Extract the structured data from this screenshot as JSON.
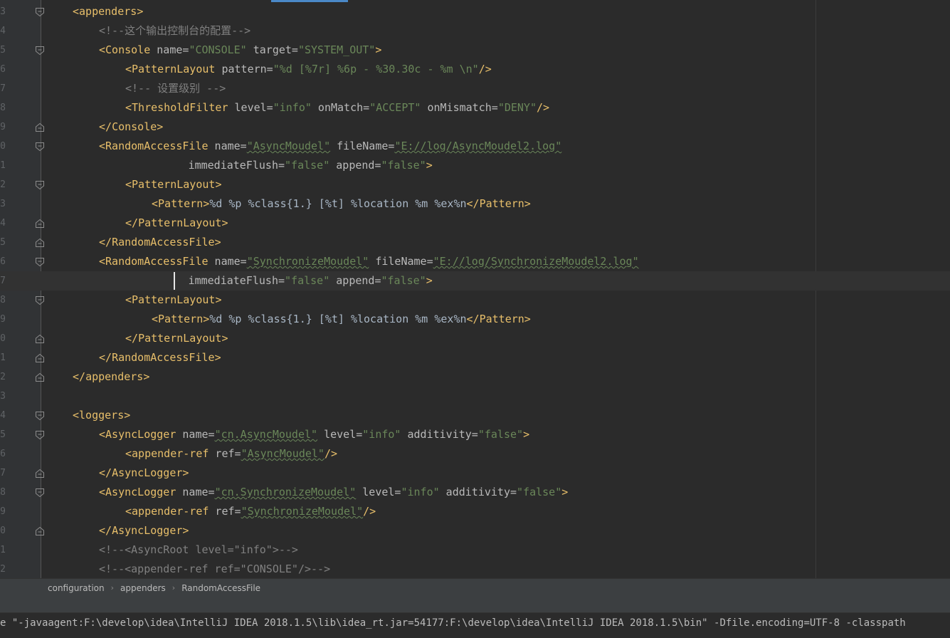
{
  "editor": {
    "lines": [
      {
        "num": "3",
        "indent": 0,
        "fold": "open",
        "tokens": [
          [
            "b",
            "<"
          ],
          [
            "n",
            "appenders"
          ],
          [
            "b",
            ">"
          ]
        ]
      },
      {
        "num": "4",
        "indent": 1,
        "fold": "",
        "tokens": [
          [
            "c",
            "<!--这个输出控制台的配置-->"
          ]
        ]
      },
      {
        "num": "5",
        "indent": 1,
        "fold": "open",
        "tokens": [
          [
            "b",
            "<"
          ],
          [
            "n",
            "Console"
          ],
          [
            "a",
            " name="
          ],
          [
            "v",
            "\"CONSOLE\""
          ],
          [
            "a",
            " target="
          ],
          [
            "v",
            "\"SYSTEM_OUT\""
          ],
          [
            "b",
            ">"
          ]
        ]
      },
      {
        "num": "6",
        "indent": 2,
        "fold": "",
        "tokens": [
          [
            "b",
            "<"
          ],
          [
            "n",
            "PatternLayout"
          ],
          [
            "a",
            " pattern="
          ],
          [
            "v",
            "\"%d [%7r] %6p - %30.30c - %m \\n\""
          ],
          [
            "b",
            "/>"
          ]
        ]
      },
      {
        "num": "7",
        "indent": 2,
        "fold": "",
        "tokens": [
          [
            "c",
            "<!-- 设置级别 -->"
          ]
        ]
      },
      {
        "num": "8",
        "indent": 2,
        "fold": "",
        "tokens": [
          [
            "b",
            "<"
          ],
          [
            "n",
            "ThresholdFilter"
          ],
          [
            "a",
            " level="
          ],
          [
            "v",
            "\"info\""
          ],
          [
            "a",
            " onMatch="
          ],
          [
            "v",
            "\"ACCEPT\""
          ],
          [
            "a",
            " onMismatch="
          ],
          [
            "v",
            "\"DENY\""
          ],
          [
            "b",
            "/>"
          ]
        ]
      },
      {
        "num": "9",
        "indent": 1,
        "fold": "close",
        "tokens": [
          [
            "b",
            "</"
          ],
          [
            "n",
            "Console"
          ],
          [
            "b",
            ">"
          ]
        ]
      },
      {
        "num": "0",
        "indent": 1,
        "fold": "open",
        "tokens": [
          [
            "b",
            "<"
          ],
          [
            "n",
            "RandomAccessFile"
          ],
          [
            "a",
            " name="
          ],
          [
            "vw",
            "\"AsyncMoudel\""
          ],
          [
            "a",
            " fileName="
          ],
          [
            "vw",
            "\"E://log/AsyncMoudel2.log\""
          ]
        ]
      },
      {
        "num": "1",
        "indent": 0,
        "fold": "",
        "tokens": [
          [
            "x",
            "                  "
          ],
          [
            "a",
            "immediateFlush="
          ],
          [
            "v",
            "\"false\""
          ],
          [
            "a",
            " append="
          ],
          [
            "v",
            "\"false\""
          ],
          [
            "b",
            ">"
          ]
        ]
      },
      {
        "num": "2",
        "indent": 2,
        "fold": "open",
        "tokens": [
          [
            "b",
            "<"
          ],
          [
            "n",
            "PatternLayout"
          ],
          [
            "b",
            ">"
          ]
        ]
      },
      {
        "num": "3",
        "indent": 3,
        "fold": "",
        "tokens": [
          [
            "b",
            "<"
          ],
          [
            "n",
            "Pattern"
          ],
          [
            "b",
            ">"
          ],
          [
            "x",
            "%d %p %class{1.} [%t] %location %m %ex%n"
          ],
          [
            "b",
            "</"
          ],
          [
            "n",
            "Pattern"
          ],
          [
            "b",
            ">"
          ]
        ]
      },
      {
        "num": "4",
        "indent": 2,
        "fold": "close",
        "tokens": [
          [
            "b",
            "</"
          ],
          [
            "n",
            "PatternLayout"
          ],
          [
            "b",
            ">"
          ]
        ]
      },
      {
        "num": "5",
        "indent": 1,
        "fold": "close",
        "tokens": [
          [
            "b",
            "</"
          ],
          [
            "n",
            "RandomAccessFile"
          ],
          [
            "b",
            ">"
          ]
        ]
      },
      {
        "num": "6",
        "indent": 1,
        "fold": "open",
        "tokens": [
          [
            "b",
            "<"
          ],
          [
            "n",
            "RandomAccessFile"
          ],
          [
            "a",
            " name="
          ],
          [
            "vw",
            "\"SynchronizeMoudel\""
          ],
          [
            "a",
            " fileName="
          ],
          [
            "vw",
            "\"E://log/SynchronizeMoudel2.log\""
          ]
        ]
      },
      {
        "num": "7",
        "indent": 0,
        "fold": "",
        "current": true,
        "tokens": [
          [
            "x",
            "                  "
          ],
          [
            "a",
            "immediateFlush="
          ],
          [
            "v",
            "\"false\""
          ],
          [
            "a",
            " append="
          ],
          [
            "v",
            "\"false\""
          ],
          [
            "b",
            ">"
          ]
        ]
      },
      {
        "num": "8",
        "indent": 2,
        "fold": "open",
        "tokens": [
          [
            "b",
            "<"
          ],
          [
            "n",
            "PatternLayout"
          ],
          [
            "b",
            ">"
          ]
        ]
      },
      {
        "num": "9",
        "indent": 3,
        "fold": "",
        "tokens": [
          [
            "b",
            "<"
          ],
          [
            "n",
            "Pattern"
          ],
          [
            "b",
            ">"
          ],
          [
            "x",
            "%d %p %class{1.} [%t] %location %m %ex%n"
          ],
          [
            "b",
            "</"
          ],
          [
            "n",
            "Pattern"
          ],
          [
            "b",
            ">"
          ]
        ]
      },
      {
        "num": "0",
        "indent": 2,
        "fold": "close",
        "tokens": [
          [
            "b",
            "</"
          ],
          [
            "n",
            "PatternLayout"
          ],
          [
            "b",
            ">"
          ]
        ]
      },
      {
        "num": "1",
        "indent": 1,
        "fold": "close",
        "tokens": [
          [
            "b",
            "</"
          ],
          [
            "n",
            "RandomAccessFile"
          ],
          [
            "b",
            ">"
          ]
        ]
      },
      {
        "num": "2",
        "indent": 0,
        "fold": "close",
        "tokens": [
          [
            "b",
            "</"
          ],
          [
            "n",
            "appenders"
          ],
          [
            "b",
            ">"
          ]
        ]
      },
      {
        "num": "3",
        "indent": 0,
        "fold": "",
        "tokens": []
      },
      {
        "num": "4",
        "indent": 0,
        "fold": "open",
        "tokens": [
          [
            "b",
            "<"
          ],
          [
            "n",
            "loggers"
          ],
          [
            "b",
            ">"
          ]
        ]
      },
      {
        "num": "5",
        "indent": 1,
        "fold": "open",
        "tokens": [
          [
            "b",
            "<"
          ],
          [
            "n",
            "AsyncLogger"
          ],
          [
            "a",
            " name="
          ],
          [
            "vw",
            "\"cn.AsyncMoudel\""
          ],
          [
            "a",
            " level="
          ],
          [
            "v",
            "\"info\""
          ],
          [
            "a",
            " additivity="
          ],
          [
            "v",
            "\"false\""
          ],
          [
            "b",
            ">"
          ]
        ]
      },
      {
        "num": "6",
        "indent": 2,
        "fold": "",
        "tokens": [
          [
            "b",
            "<"
          ],
          [
            "n",
            "appender-ref"
          ],
          [
            "a",
            " ref="
          ],
          [
            "vw",
            "\"AsyncMoudel\""
          ],
          [
            "b",
            "/>"
          ]
        ]
      },
      {
        "num": "7",
        "indent": 1,
        "fold": "close",
        "tokens": [
          [
            "b",
            "</"
          ],
          [
            "n",
            "AsyncLogger"
          ],
          [
            "b",
            ">"
          ]
        ]
      },
      {
        "num": "8",
        "indent": 1,
        "fold": "open",
        "tokens": [
          [
            "b",
            "<"
          ],
          [
            "n",
            "AsyncLogger"
          ],
          [
            "a",
            " name="
          ],
          [
            "vw",
            "\"cn.SynchronizeMoudel\""
          ],
          [
            "a",
            " level="
          ],
          [
            "v",
            "\"info\""
          ],
          [
            "a",
            " additivity="
          ],
          [
            "v",
            "\"false\""
          ],
          [
            "b",
            ">"
          ]
        ]
      },
      {
        "num": "9",
        "indent": 2,
        "fold": "",
        "tokens": [
          [
            "b",
            "<"
          ],
          [
            "n",
            "appender-ref"
          ],
          [
            "a",
            " ref="
          ],
          [
            "vw",
            "\"SynchronizeMoudel\""
          ],
          [
            "b",
            "/>"
          ]
        ]
      },
      {
        "num": "0",
        "indent": 1,
        "fold": "close",
        "tokens": [
          [
            "b",
            "</"
          ],
          [
            "n",
            "AsyncLogger"
          ],
          [
            "b",
            ">"
          ]
        ]
      },
      {
        "num": "1",
        "indent": 1,
        "fold": "",
        "tokens": [
          [
            "c",
            "<!--<AsyncRoot level=\"info\">-->"
          ]
        ]
      },
      {
        "num": "2",
        "indent": 1,
        "fold": "",
        "tokens": [
          [
            "c",
            "<!--<appender-ref ref=\"CONSOLE\"/>-->"
          ]
        ]
      }
    ]
  },
  "breadcrumb": {
    "items": [
      "configuration",
      "appenders",
      "RandomAccessFile"
    ],
    "separator": "›"
  },
  "console": {
    "text": "e \"-javaagent:F:\\develop\\idea\\IntelliJ IDEA 2018.1.5\\lib\\idea_rt.jar=54177:F:\\develop\\idea\\IntelliJ IDEA 2018.1.5\\bin\" -Dfile.encoding=UTF-8 -classpath"
  },
  "colors": {
    "background": "#2b2b2b",
    "tag": "#e8bf6a",
    "attribute": "#bababa",
    "value": "#6a8759",
    "comment": "#808080",
    "accent": "#4a88c7"
  }
}
